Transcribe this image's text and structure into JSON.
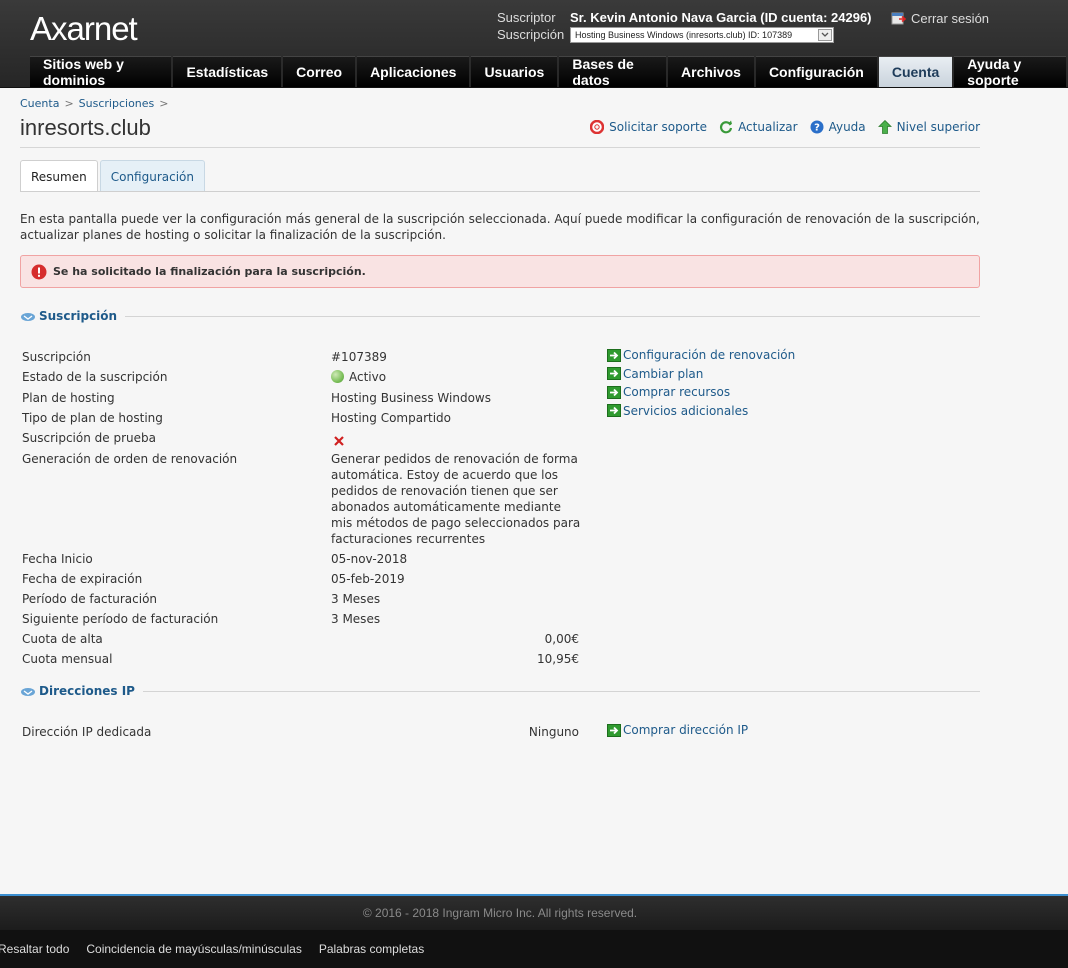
{
  "brand": {
    "name": "Axarnet"
  },
  "header": {
    "subscriber_label": "Suscriptor",
    "subscriber_name": "Sr. Kevin Antonio Nava Garcia (ID cuenta: 24296)",
    "subscription_label": "Suscripción",
    "subscription_selected": "Hosting Business Windows (inresorts.club) ID: 107389",
    "logout": "Cerrar sesión"
  },
  "nav": {
    "tabs": [
      {
        "label": "Sitios web y dominios",
        "active": false
      },
      {
        "label": "Estadísticas",
        "active": false
      },
      {
        "label": "Correo",
        "active": false
      },
      {
        "label": "Aplicaciones",
        "active": false
      },
      {
        "label": "Usuarios",
        "active": false
      },
      {
        "label": "Bases de datos",
        "active": false
      },
      {
        "label": "Archivos",
        "active": false
      },
      {
        "label": "Configuración",
        "active": false
      },
      {
        "label": "Cuenta",
        "active": true
      },
      {
        "label": "Ayuda y soporte",
        "active": false
      }
    ]
  },
  "breadcrumb": {
    "items": [
      "Cuenta",
      "Suscripciones"
    ],
    "sep": ">"
  },
  "page": {
    "title": "inresorts.club"
  },
  "actions": {
    "support": "Solicitar soporte",
    "refresh": "Actualizar",
    "help": "Ayuda",
    "up": "Nivel superior"
  },
  "tabs": {
    "summary": "Resumen",
    "config": "Configuración"
  },
  "intro": "En esta pantalla puede ver la configuración más general de la suscripción seleccionada. Aquí puede modificar la configuración de renovación de la suscripción, actualizar planes de hosting o solicitar la finalización de la suscripción.",
  "alert": "Se ha solicitado la finalización para la suscripción.",
  "subscription_section": {
    "title": "Suscripción",
    "rows": [
      {
        "label": "Suscripción",
        "value": "#107389"
      },
      {
        "label": "Estado de la suscripción",
        "value": "Activo"
      },
      {
        "label": "Plan de hosting",
        "value": "Hosting Business Windows"
      },
      {
        "label": "Tipo de plan de hosting",
        "value": "Hosting Compartido"
      },
      {
        "label": "Suscripción de prueba",
        "value": ""
      },
      {
        "label": "Generación de orden de renovación",
        "value": "Generar pedidos de renovación de forma automática. Estoy de acuerdo que los pedidos de renovación tienen que ser abonados automáticamente mediante mis métodos de pago seleccionados para facturaciones recurrentes"
      },
      {
        "label": "Fecha Inicio",
        "value": "05-nov-2018"
      },
      {
        "label": "Fecha de expiración",
        "value": "05-feb-2019"
      },
      {
        "label": "Período de facturación",
        "value": "3 Meses"
      },
      {
        "label": "Siguiente período de facturación",
        "value": "3 Meses"
      },
      {
        "label": "Cuota de alta",
        "value": "0,00€"
      },
      {
        "label": "Cuota mensual",
        "value": "10,95€"
      }
    ],
    "links": [
      "Configuración de renovación",
      "Cambiar plan",
      "Comprar recursos",
      "Servicios adicionales"
    ]
  },
  "ip_section": {
    "title": "Direcciones IP",
    "label": "Dirección IP dedicada",
    "value": "Ninguno",
    "link": "Comprar dirección IP"
  },
  "footer": {
    "copyright": "© 2016 - 2018 Ingram Micro Inc. All rights reserved."
  },
  "findbar": {
    "items": [
      "Resaltar todo",
      "Coincidencia de mayúsculas/minúsculas",
      "Palabras completas"
    ]
  },
  "colors": {
    "link": "#1e5a8a",
    "nav_bg": "#000000",
    "active_tab": "#c9d3dc",
    "alert_bg": "#f9e3e3",
    "status_active": "#7cbf5a"
  }
}
